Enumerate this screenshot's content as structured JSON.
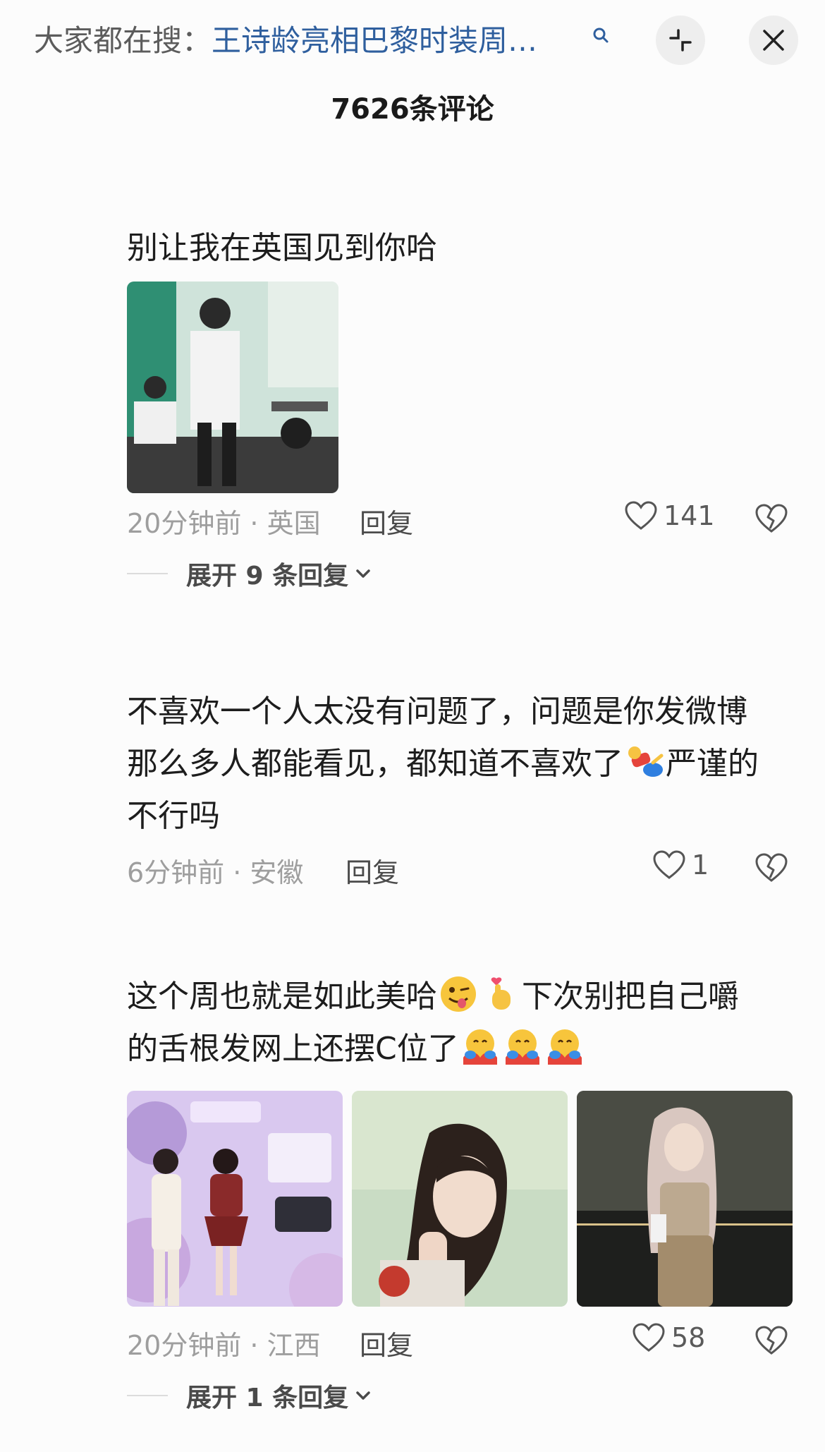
{
  "header": {
    "search_prefix": "大家都在搜：",
    "search_topic": "王诗龄亮相巴黎时装周…",
    "comment_count": "7626条评论"
  },
  "comments": [
    {
      "text": "别让我在英国见到你哈",
      "time_location": "20分钟前 · 英国",
      "reply_label": "回复",
      "likes": "141",
      "expand_label": "展开 9 条回复"
    },
    {
      "text_line1": "不喜欢一个人太没有问题了，问题是你发微博",
      "text_line2a": "那么多人都能看见，都知道不喜欢了",
      "text_line2b": "严谨的",
      "text_line3": "不行吗",
      "time_location": "6分钟前 · 安徽",
      "reply_label": "回复",
      "likes": "1"
    },
    {
      "text_line1a": "这个周也就是如此美哈",
      "text_line1b": "下次别把自己嚼",
      "text_line2": "的舌根发网上还摆C位了",
      "time_location": "20分钟前 · 江西",
      "reply_label": "回复",
      "likes": "58",
      "expand_label": "展开 1 条回复"
    }
  ],
  "icons": [
    "search-icon",
    "collapse-icon",
    "close-icon",
    "heart-icon",
    "broken-heart-icon",
    "chevron-down-icon"
  ],
  "colors": {
    "link_blue": "#2f5f9e",
    "meta_gray": "#9e9e9e",
    "text": "#1d1d1d"
  }
}
